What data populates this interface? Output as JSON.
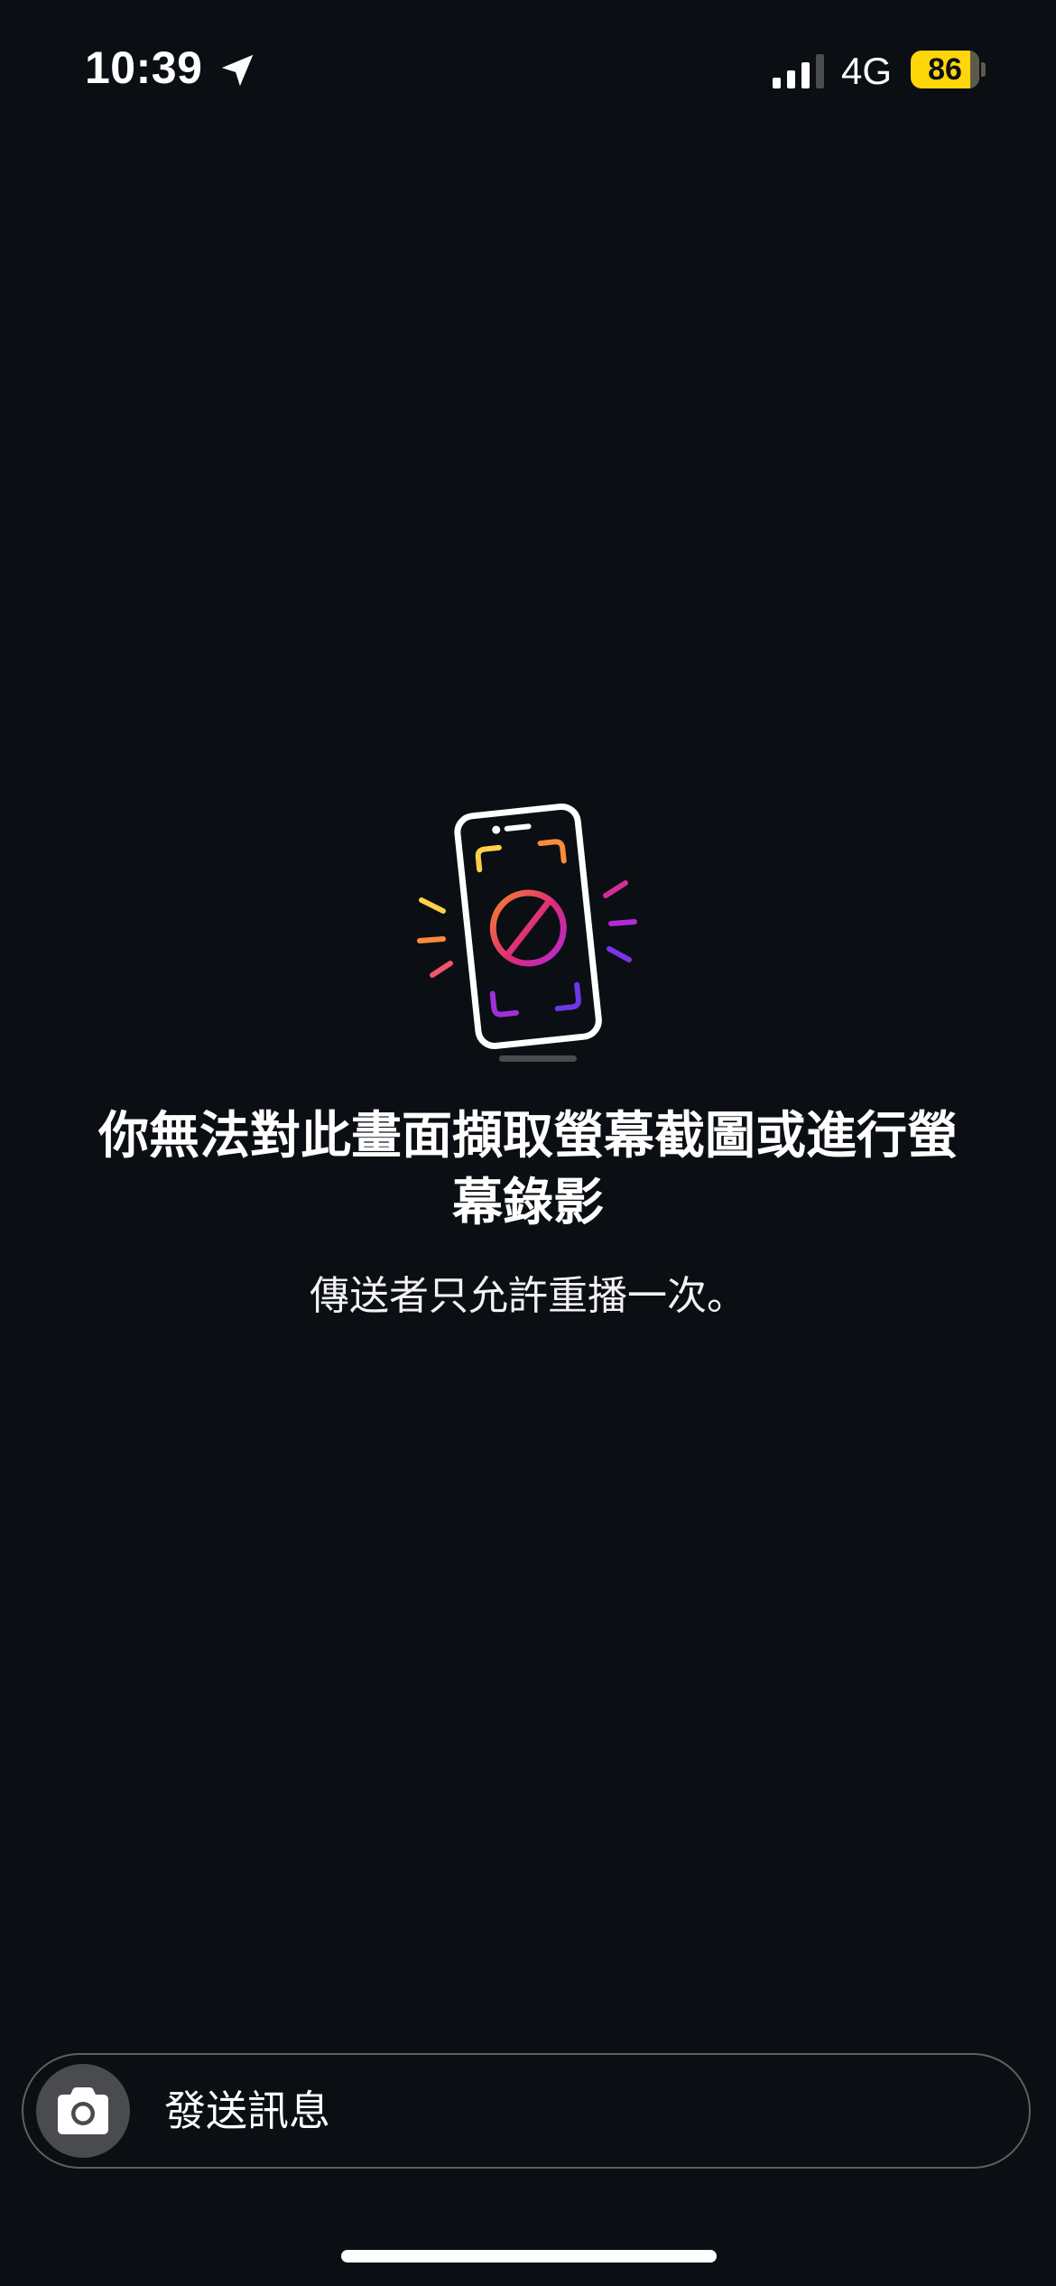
{
  "status_bar": {
    "time": "10:39",
    "location_icon": "location-arrow-icon",
    "signal_icon": "cellular-signal-icon",
    "network": "4G",
    "battery_level": "86",
    "battery_color": "#ffd60a"
  },
  "blocked_notice": {
    "illustration_icon": "screenshot-blocked-phone-icon",
    "title": "你無法對此畫面擷取螢幕截圖或進行螢幕錄影",
    "subtitle": "傳送者只允許重播一次。"
  },
  "composer": {
    "camera_icon": "camera-icon",
    "placeholder": "發送訊息"
  },
  "colors": {
    "background": "#0b0e13",
    "composer_border": "#5d5f63",
    "camera_button": "#4a4b4f"
  }
}
